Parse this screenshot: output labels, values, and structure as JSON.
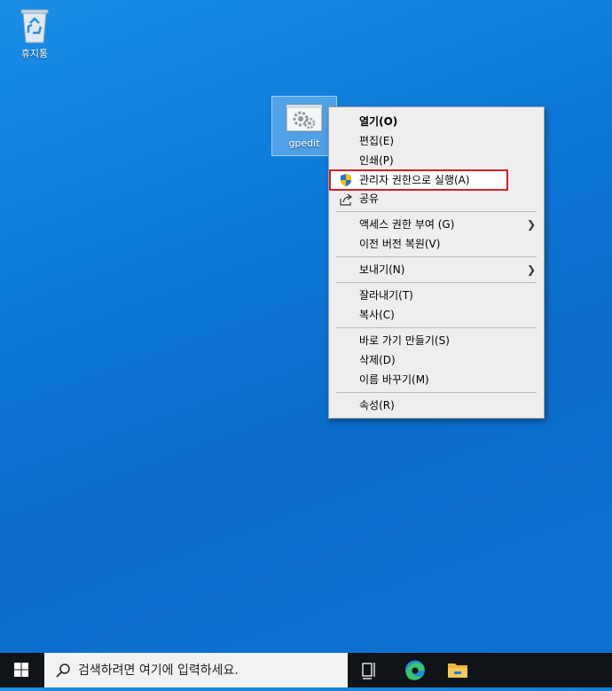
{
  "desktop": {
    "icons": [
      {
        "label": "휴지통",
        "icon": "recycle-bin-icon"
      },
      {
        "label": "gpedit",
        "icon": "gpedit-shortcut-icon"
      }
    ]
  },
  "context_menu": {
    "items": {
      "open": "열기(O)",
      "edit": "편집(E)",
      "print": "인쇄(P)",
      "run_as_admin": "관리자 권한으로 실행(A)",
      "share": "공유",
      "give_access": "액세스 권한 부여 (G)",
      "restore_previous": "이전 버전 복원(V)",
      "send_to": "보내기(N)",
      "cut": "잘라내기(T)",
      "copy": "복사(C)",
      "create_shortcut": "바로 가기 만들기(S)",
      "delete": "삭제(D)",
      "rename": "이름 바꾸기(M)",
      "properties": "속성(R)"
    },
    "highlight_color": "#d32028"
  },
  "taskbar": {
    "search_placeholder": "검색하려면 여기에 입력하세요.",
    "buttons": [
      "windows-start-icon",
      "task-view-icon",
      "edge-icon",
      "file-explorer-icon"
    ]
  }
}
